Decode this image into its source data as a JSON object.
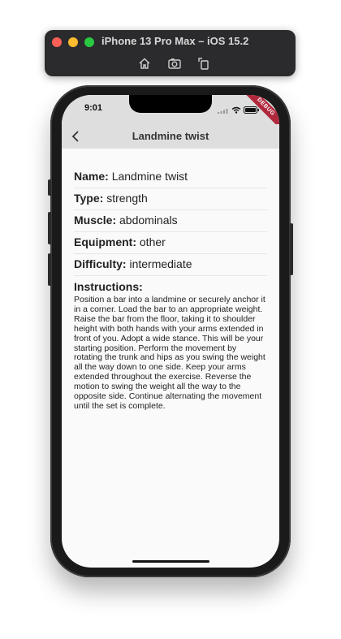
{
  "simulator": {
    "title": "iPhone 13 Pro Max – iOS 15.2",
    "tools": [
      "home-icon",
      "screenshot-icon",
      "rotate-icon"
    ]
  },
  "status_bar": {
    "time": "9:01",
    "debug_label": "DEBUG"
  },
  "app_bar": {
    "title": "Landmine twist",
    "back_icon": "chevron-left-icon"
  },
  "exercise": {
    "name_label": "Name:",
    "name_value": "Landmine twist",
    "type_label": "Type:",
    "type_value": "strength",
    "muscle_label": "Muscle:",
    "muscle_value": "abdominals",
    "equipment_label": "Equipment:",
    "equipment_value": "other",
    "difficulty_label": "Difficulty:",
    "difficulty_value": "intermediate",
    "instructions_label": "Instructions:",
    "instructions_text": "Position a bar into a landmine or securely anchor it in a corner. Load the bar to an appropriate weight. Raise the bar from the floor, taking it to shoulder height with both hands with your arms extended in front of you. Adopt a wide stance. This will be your starting position. Perform the movement by rotating the trunk and hips as you swing the weight all the way down to one side. Keep your arms extended throughout the exercise. Reverse the motion to swing the weight all the way to the opposite side. Continue alternating the movement until the set is complete."
  }
}
